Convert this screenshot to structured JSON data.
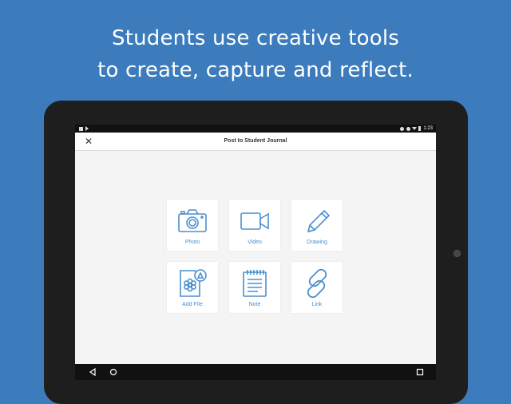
{
  "headline": {
    "line1": "Students use creative tools",
    "line2": "to create, capture and reflect."
  },
  "status_bar": {
    "time": "1:23",
    "icons": [
      "notification-icon",
      "play-icon",
      "bluetooth-icon",
      "do-not-disturb-icon",
      "wifi-icon",
      "battery-icon"
    ]
  },
  "app_bar": {
    "close_label": "✕",
    "title": "Post to Student Journal"
  },
  "tiles": [
    {
      "label": "Photo",
      "icon": "camera-icon"
    },
    {
      "label": "Video",
      "icon": "video-camera-icon"
    },
    {
      "label": "Drawing",
      "icon": "pencil-icon"
    },
    {
      "label": "Add File",
      "icon": "file-icon"
    },
    {
      "label": "Note",
      "icon": "notepad-icon"
    },
    {
      "label": "Link",
      "icon": "link-icon"
    }
  ],
  "nav_bar": {
    "icons": [
      "back-icon",
      "home-icon",
      "recents-icon"
    ]
  },
  "colors": {
    "background": "#3c7cbd",
    "accent": "#4a8fd0",
    "device": "#1e1e1e"
  }
}
